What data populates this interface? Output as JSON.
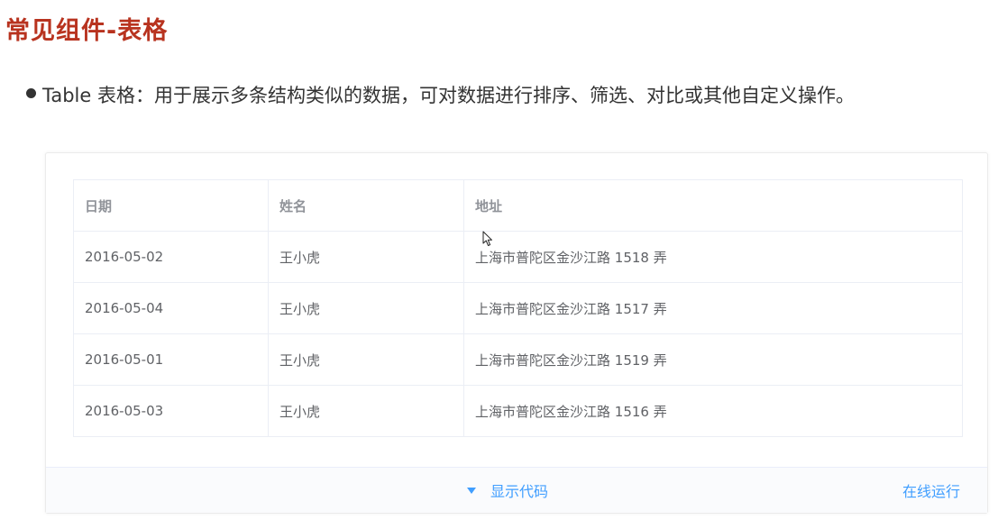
{
  "page": {
    "title": "常见组件-表格",
    "bullet": "Table 表格：用于展示多条结构类似的数据，可对数据进行排序、筛选、对比或其他自定义操作。"
  },
  "table": {
    "headers": [
      "日期",
      "姓名",
      "地址"
    ],
    "rows": [
      [
        "2016-05-02",
        "王小虎",
        "上海市普陀区金沙江路 1518 弄"
      ],
      [
        "2016-05-04",
        "王小虎",
        "上海市普陀区金沙江路 1517 弄"
      ],
      [
        "2016-05-01",
        "王小虎",
        "上海市普陀区金沙江路 1519 弄"
      ],
      [
        "2016-05-03",
        "王小虎",
        "上海市普陀区金沙江路 1516 弄"
      ]
    ]
  },
  "footer": {
    "toggle_label": "显示代码",
    "run_label": "在线运行"
  },
  "icons": {
    "toggle": "caret-down-icon",
    "cursor": "mouse-cursor-icon"
  },
  "colors": {
    "title": "#b8331f",
    "link": "#409eff",
    "border": "#ebeef5"
  }
}
